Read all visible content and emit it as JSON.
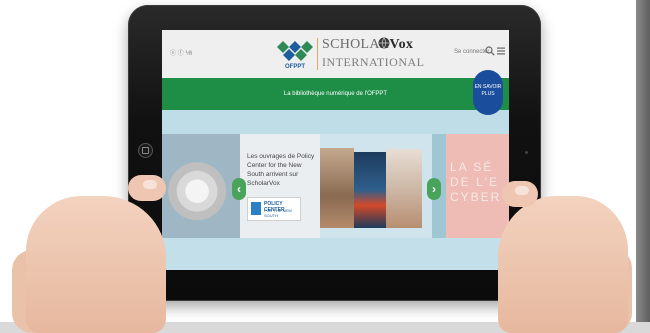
{
  "header": {
    "language": "ⓔ ⓕ ⅟ð",
    "ofppt_label": "OFPPT",
    "brand_prefix": "SCHOLAR",
    "brand_bold": "Vox",
    "brand_line2": "INTERNATIONAL",
    "connect_label": "Se connecter",
    "icons": [
      "ofppt-logo-icon",
      "globe-icon",
      "search-icon",
      "menu-icon"
    ]
  },
  "banner": {
    "text": "La bibliothèque numérique de l'OFPPT",
    "cta_label": "EN SAVOIR PLUS"
  },
  "slider": {
    "promo_text": "Les ouvrages de Policy Center for the New South arrivent sur ScholarVox",
    "partner_logo_line1": "POLICY CENTER",
    "partner_logo_line2": "FOR THE NEW SOUTH",
    "right_card_text": "LA SÉ\nDE L'E\nCYBER",
    "prev_label": "‹",
    "next_label": "›"
  },
  "colors": {
    "green": "#1e8d46",
    "blue_cta": "#1a4e9c",
    "slider_bg": "#cfe4ec"
  }
}
